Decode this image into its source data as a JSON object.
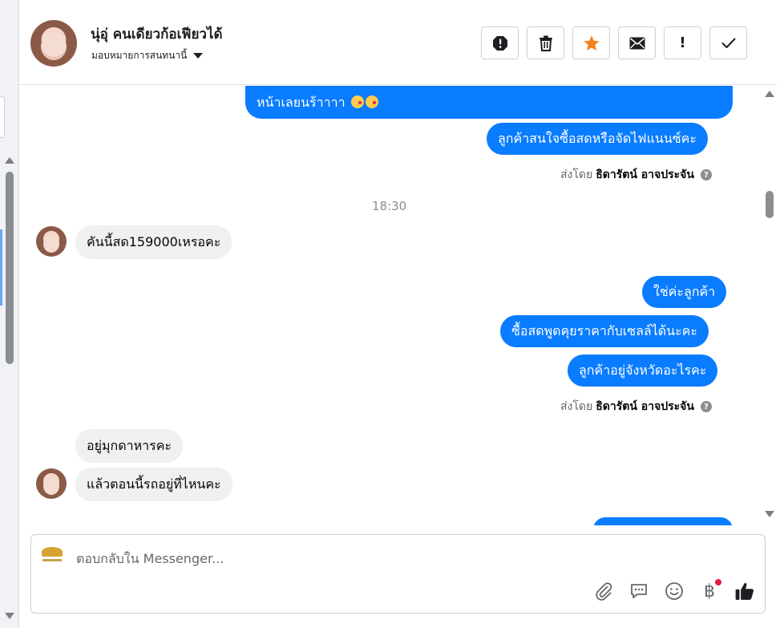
{
  "contact": {
    "name": "นุ่อุ่ คนเดียวก้อเฟียวได้",
    "assign_label": "มอบหมายการสนทนานี้"
  },
  "actions": [
    {
      "name": "spam-button",
      "icon": "octagon-exclamation-icon"
    },
    {
      "name": "delete-button",
      "icon": "trash-icon"
    },
    {
      "name": "star-button",
      "icon": "star-icon",
      "color": "#f5821f"
    },
    {
      "name": "mark-unread-button",
      "icon": "envelope-icon"
    },
    {
      "name": "follow-up-button",
      "icon": "exclamation-icon",
      "glyph": "!"
    },
    {
      "name": "mark-done-button",
      "icon": "check-icon"
    }
  ],
  "messages": {
    "first_out_partial": "หน้าเลยนร้าาาา",
    "first_out_emojis": "😘😘",
    "out_1": "ลูกค้าสนใจซื้อสดหรือจัดไฟแนนซ์คะ",
    "sent_by_prefix": "ส่งโดย",
    "sent_by_name": "ธิดารัตน์ อาจประจัน",
    "sent_by_help": "?",
    "timestamp": "18:30",
    "in_1": "คันนี้สด159000เหรอคะ",
    "out_2": "ใช่ค่ะลูกค้า",
    "out_3": "ซื้อสดพูดคุยราคากับเซลล์ได้นะคะ",
    "out_4": "ลูกค้าอยู่จังหวัดอะไรคะ",
    "sent_by_prefix_2": "ส่งโดย",
    "sent_by_name_2": "ธิดารัตน์ อาจประจัน",
    "in_2": "อยู่มุกดาหารคะ",
    "in_3": "แล้วตอนนี้รถอยู่ที่ไหนคะ"
  },
  "composer": {
    "placeholder": "ตอบกลับใน Messenger...",
    "tools": [
      "paperclip-icon",
      "saved-reply-icon",
      "emoji-icon",
      "baht-icon",
      "thumbs-up-icon"
    ],
    "baht_glyph": "฿"
  },
  "colors": {
    "outgoing_bubble": "#0a7cff",
    "incoming_bubble": "#f0f0f0",
    "like_button": "#1877f2"
  }
}
